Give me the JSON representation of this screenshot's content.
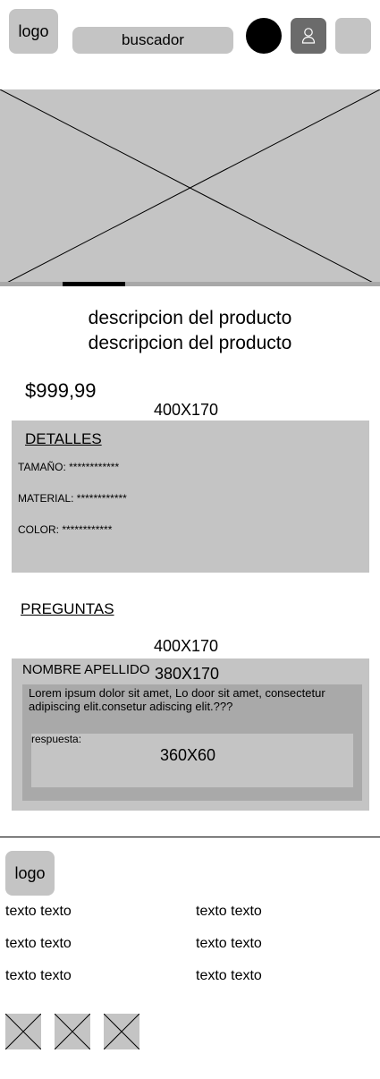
{
  "header": {
    "logo": "logo",
    "search_label": "buscador"
  },
  "product": {
    "description_line1": "descripcion del producto",
    "description_line2": "descripcion del producto",
    "price": "$999,99",
    "details_box_dims": "400X170"
  },
  "details": {
    "title": "DETALLES",
    "specs": [
      "TAMAÑO: ************",
      "MATERIAL: ************",
      "COLOR: ************"
    ]
  },
  "questions": {
    "title": "PREGUNTAS",
    "card_dims": "400X170",
    "inner_dims": "380X170",
    "user_name": "NOMBRE APELLIDO",
    "question_text": "Lorem ipsum dolor sit amet, Lo door sit amet, consectetur adipiscing elit.consetur adiscing elit.???",
    "answer_label": "respuesta:",
    "answer_dims": "360X60"
  },
  "footer": {
    "logo": "logo",
    "links_left": [
      "texto texto",
      "texto texto",
      "texto texto"
    ],
    "links_right": [
      "texto texto",
      "texto texto",
      "texto texto"
    ],
    "social_icons": [
      "placeholder-image-icon",
      "placeholder-image-icon",
      "placeholder-image-icon"
    ]
  },
  "colors": {
    "placeholder_gray": "#c4c4c4",
    "dark_gray": "#6b6b6b",
    "inner_gray": "#a9a9a9",
    "carousel_active": "#000000"
  }
}
